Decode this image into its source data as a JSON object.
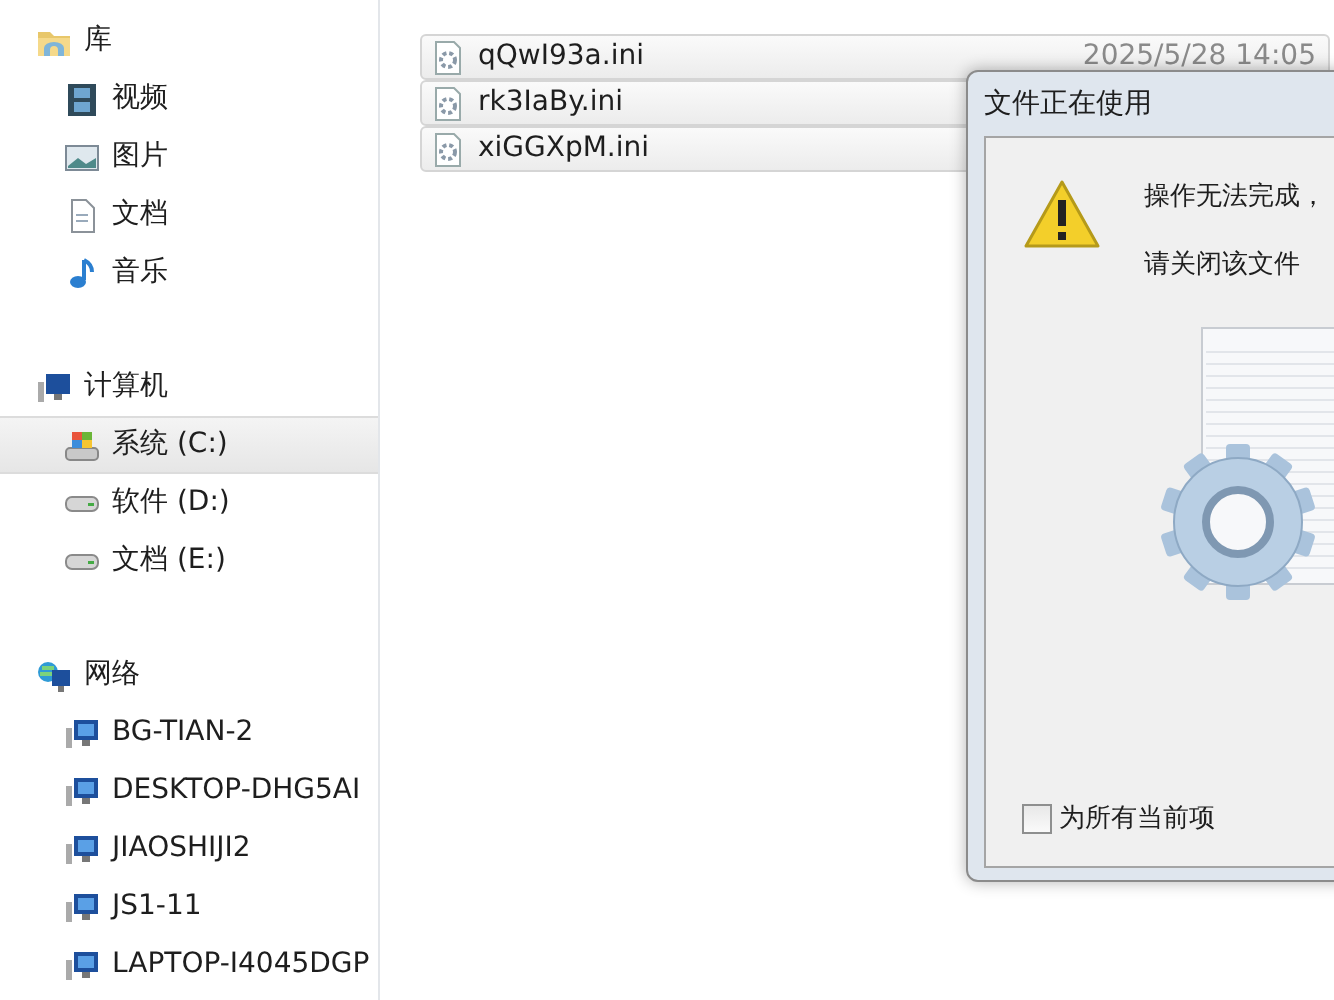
{
  "sidebar": {
    "groups": [
      {
        "kind": "library",
        "label": "库",
        "items": [
          {
            "kind": "video",
            "label": "视频",
            "selected": false
          },
          {
            "kind": "picture",
            "label": "图片",
            "selected": false
          },
          {
            "kind": "document",
            "label": "文档",
            "selected": false
          },
          {
            "kind": "music",
            "label": "音乐",
            "selected": false
          }
        ]
      },
      {
        "kind": "computer",
        "label": "计算机",
        "items": [
          {
            "kind": "system-drive",
            "label": "系统 (C:)",
            "selected": true
          },
          {
            "kind": "drive",
            "label": "软件 (D:)",
            "selected": false
          },
          {
            "kind": "drive",
            "label": "文档 (E:)",
            "selected": false
          }
        ]
      },
      {
        "kind": "network",
        "label": "网络",
        "items": [
          {
            "kind": "pc",
            "label": "BG-TIAN-2",
            "selected": false
          },
          {
            "kind": "pc",
            "label": "DESKTOP-DHG5AI",
            "selected": false
          },
          {
            "kind": "pc",
            "label": "JIAOSHIJI2",
            "selected": false
          },
          {
            "kind": "pc",
            "label": "JS1-11",
            "selected": false
          },
          {
            "kind": "pc",
            "label": "LAPTOP-I4045DGP",
            "selected": false
          }
        ]
      }
    ]
  },
  "files": [
    {
      "name": "qQwI93a.ini",
      "date": "2025/5/28 14:05"
    },
    {
      "name": "rk3IaBy.ini"
    },
    {
      "name": "xiGGXpM.ini"
    }
  ],
  "dialog": {
    "title": "文件正在使用",
    "message": "操作无法完成，",
    "instruction": "请关闭该文件",
    "checkbox": {
      "label": "为所有当前项",
      "checked": false
    }
  }
}
